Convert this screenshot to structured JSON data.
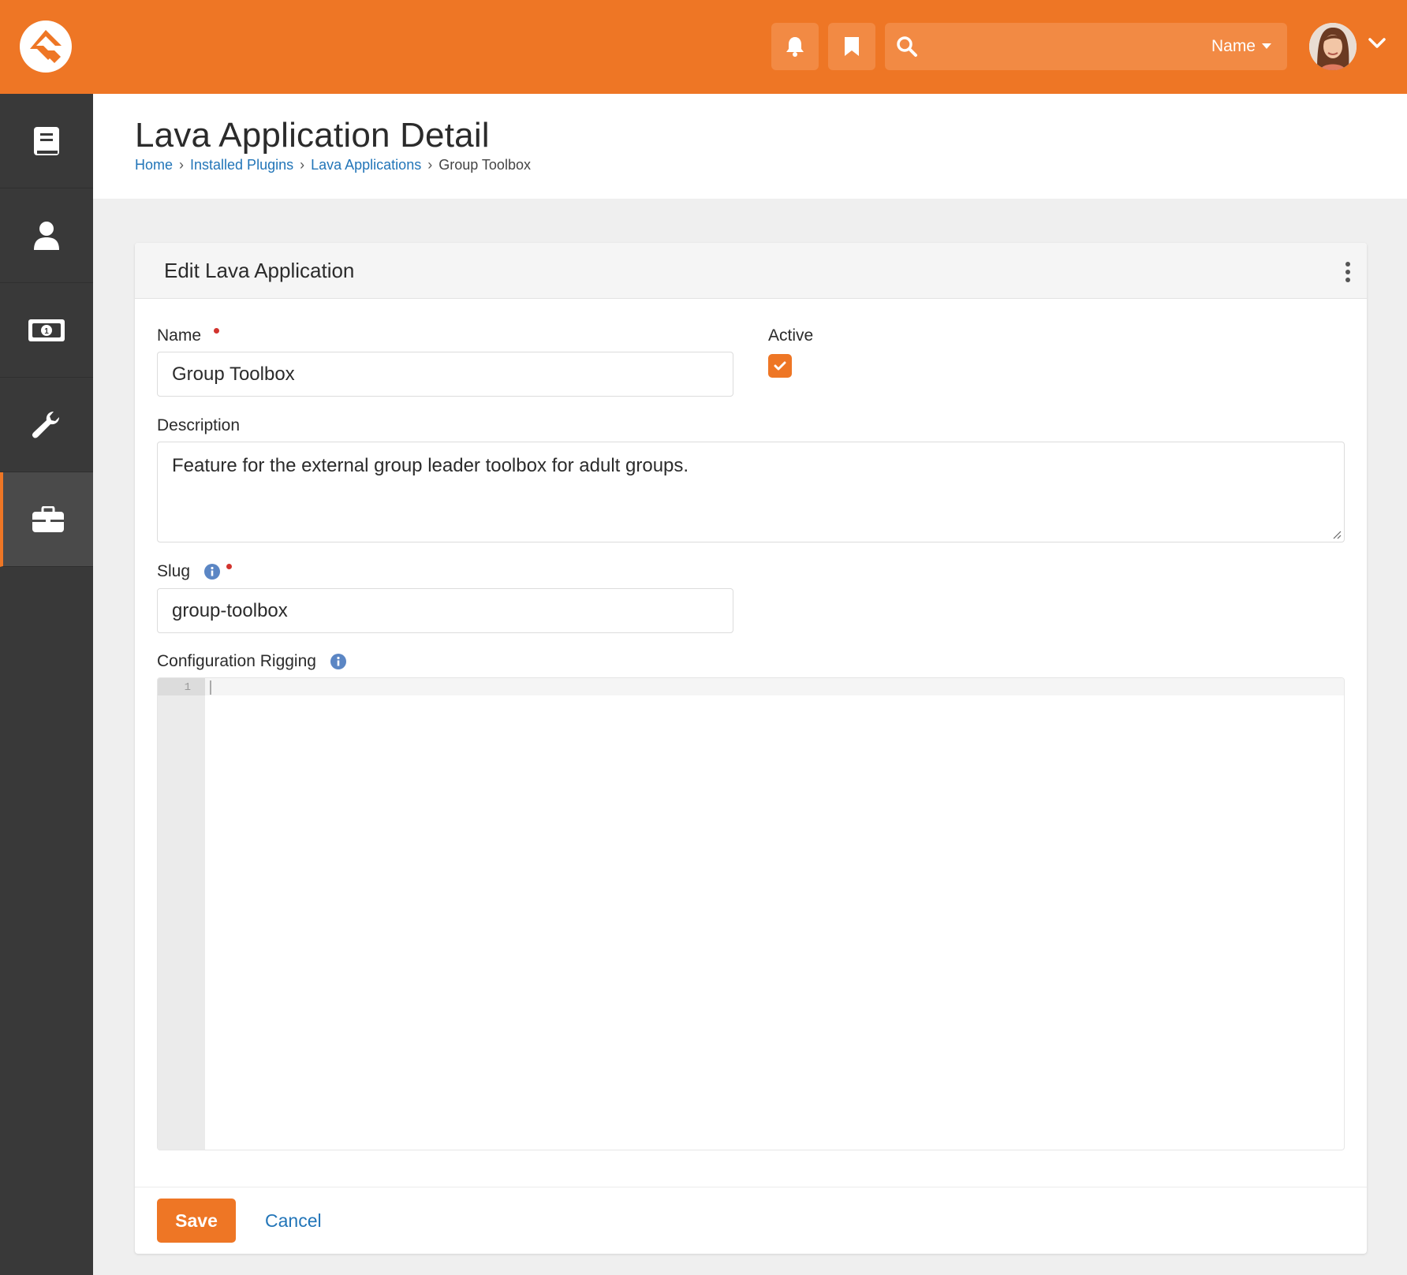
{
  "topbar": {
    "search_placeholder": "",
    "search_scope": "Name",
    "logo_icon": "rock-logo-icon",
    "bell_icon": "bell-icon",
    "bookmark_icon": "bookmark-icon",
    "search_icon": "search-icon",
    "accent_color": "#ee7625"
  },
  "sidebar": {
    "items": [
      {
        "icon": "book-icon",
        "active": false
      },
      {
        "icon": "person-icon",
        "active": false
      },
      {
        "icon": "money-icon",
        "active": false
      },
      {
        "icon": "wrench-icon",
        "active": false
      },
      {
        "icon": "briefcase-icon",
        "active": true
      }
    ]
  },
  "page": {
    "title": "Lava Application Detail",
    "breadcrumb": [
      "Home",
      "Installed Plugins",
      "Lava Applications",
      "Group Toolbox"
    ]
  },
  "panel": {
    "title": "Edit Lava Application",
    "name_label": "Name",
    "name_value": "Group Toolbox",
    "active_label": "Active",
    "active_checked": true,
    "description_label": "Description",
    "description_value": "Feature for the external group leader toolbox for adult groups.",
    "slug_label": "Slug",
    "slug_value": "group-toolbox",
    "config_label": "Configuration Rigging",
    "editor_line_number": "1",
    "save_label": "Save",
    "cancel_label": "Cancel"
  }
}
